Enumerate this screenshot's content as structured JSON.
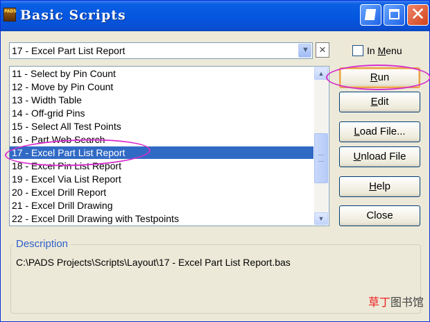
{
  "window": {
    "title": "Basic Scripts",
    "app_icon_text": "PADS",
    "close_glyph": "✕"
  },
  "script_combo": {
    "value": "17 - Excel Part List Report",
    "dropdown_glyph": "▼",
    "clear_glyph": "×"
  },
  "in_menu": {
    "checked": false,
    "label_prefix": "In ",
    "label_accel": "M",
    "label_rest": "enu"
  },
  "script_list": {
    "items": [
      "11 - Select by Pin Count",
      "12 - Move by Pin Count",
      "13 - Width Table",
      "14 - Off-grid Pins",
      "15 - Select All Test Points",
      "16 - Part Web Search",
      "17 - Excel Part List Report",
      "18 - Excel Pin List Report",
      "19 - Excel Via List Report",
      "20 - Excel Drill Report",
      "21 - Excel Drill Drawing",
      "22 - Excel Drill Drawing with Testpoints"
    ],
    "selected_index": 6,
    "scroll_up_glyph": "▲",
    "scroll_down_glyph": "▼"
  },
  "buttons": {
    "run": {
      "accel": "R",
      "rest": "un"
    },
    "edit": {
      "accel": "E",
      "rest": "dit"
    },
    "load_file": {
      "accel": "L",
      "rest": "oad File..."
    },
    "unload_file": {
      "accel": "U",
      "rest": "nload File"
    },
    "help": {
      "accel": "H",
      "rest": "elp"
    },
    "close": {
      "label": "Close"
    }
  },
  "description": {
    "label": "Description",
    "text": "C:\\PADS Projects\\Scripts\\Layout\\17 - Excel Part List Report.bas"
  },
  "watermark": {
    "red_part": "草丁",
    "dark_part": "图书馆"
  },
  "colors": {
    "title_bar": "#0456e0",
    "selection": "#316ac5",
    "annotation": "#d62fcc",
    "default_button_ring": "#e9a24a"
  }
}
